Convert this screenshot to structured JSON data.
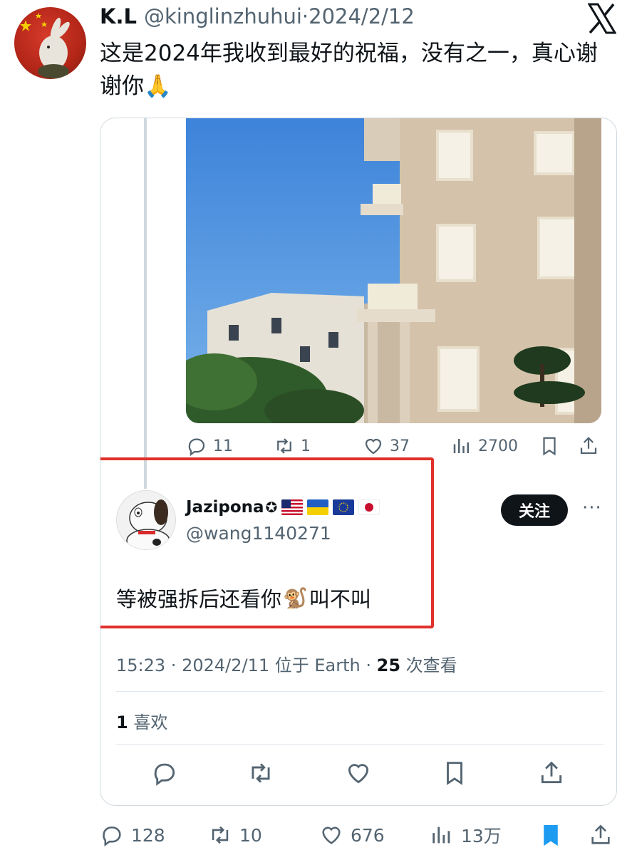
{
  "author": {
    "name": "K.L",
    "handle": "@kinglinzhuhui",
    "date_sep": "·",
    "date": "2024/2/12"
  },
  "tweet_text": "这是2024年我收到最好的祝福，没有之一，真心谢谢你🙏",
  "embedded_post": {
    "actions": {
      "replies": "11",
      "reposts": "1",
      "likes": "37",
      "views": "2700"
    },
    "reply": {
      "name": "Jazipona",
      "badge": "✪",
      "flags": [
        "US",
        "UA",
        "EU",
        "JP"
      ],
      "handle": "@wang1140271",
      "follow_label": "关注",
      "more_label": "···",
      "text_before": "等被强拆后还看你",
      "emoji": "🐒",
      "text_after": "叫不叫"
    },
    "meta": {
      "time": "15:23",
      "sep": " · ",
      "date": "2024/2/11",
      "location": " 位于 Earth",
      "sep2": " · ",
      "views_count": "25",
      "views_label": " 次查看"
    },
    "likes": {
      "count": "1",
      "label": " 喜欢"
    }
  },
  "outer_actions": {
    "replies": "128",
    "reposts": "10",
    "likes": "676",
    "views": "13万"
  },
  "colors": {
    "text": "#0f1419",
    "muted": "#536471",
    "highlight_box": "#e0302a",
    "bookmark_active": "#1d9bf0",
    "sky": "#5a9be0"
  }
}
